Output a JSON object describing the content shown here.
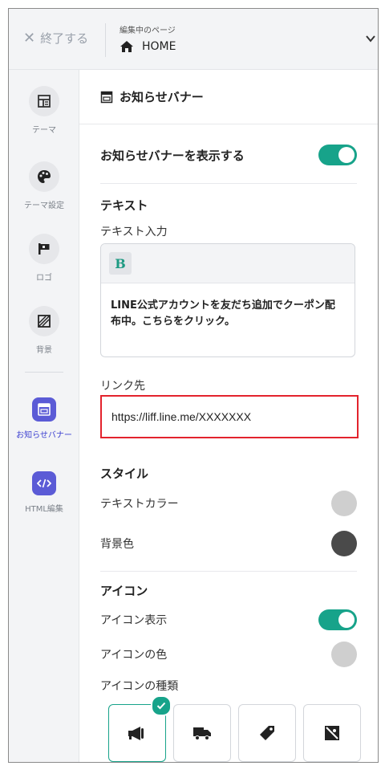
{
  "header": {
    "exit_label": "終了する",
    "editing_caption": "編集中のページ",
    "page_name": "HOME"
  },
  "sidebar": {
    "items": [
      {
        "label": "テーマ",
        "icon": "layout-icon"
      },
      {
        "label": "テーマ設定",
        "icon": "palette-icon"
      },
      {
        "label": "ロゴ",
        "icon": "flag-icon"
      },
      {
        "label": "背景",
        "icon": "background-icon"
      },
      {
        "label": "お知らせバナー",
        "icon": "banner-icon",
        "active": true
      },
      {
        "label": "HTML編集",
        "icon": "code-icon",
        "active": true
      }
    ]
  },
  "panel": {
    "title": "お知らせバナー",
    "show_banner_label": "お知らせバナーを表示する",
    "show_banner_on": true,
    "text_section": "テキスト",
    "text_input_label": "テキスト入力",
    "bold_button": "B",
    "text_content": "LINE公式アカウントを友だち追加でクーポン配布中。こちらをクリック。",
    "link_label": "リンク先",
    "link_value": "https://liff.line.me/XXXXXXX",
    "style_section": "スタイル",
    "text_color_label": "テキストカラー",
    "text_color": "#cfcfcf",
    "bg_color_label": "背景色",
    "bg_color": "#4a4a4a",
    "icon_section": "アイコン",
    "icon_show_label": "アイコン表示",
    "icon_show_on": true,
    "icon_color_label": "アイコンの色",
    "icon_color": "#cfcfcf",
    "icon_type_label": "アイコンの種類",
    "icon_types": [
      "megaphone-icon",
      "truck-icon",
      "tag-icon",
      "discount-icon"
    ],
    "selected_icon": "megaphone-icon"
  },
  "colors": {
    "accent": "#17a38a",
    "sidebar_active": "#5b5bd6",
    "highlight_border": "#e3232d"
  }
}
